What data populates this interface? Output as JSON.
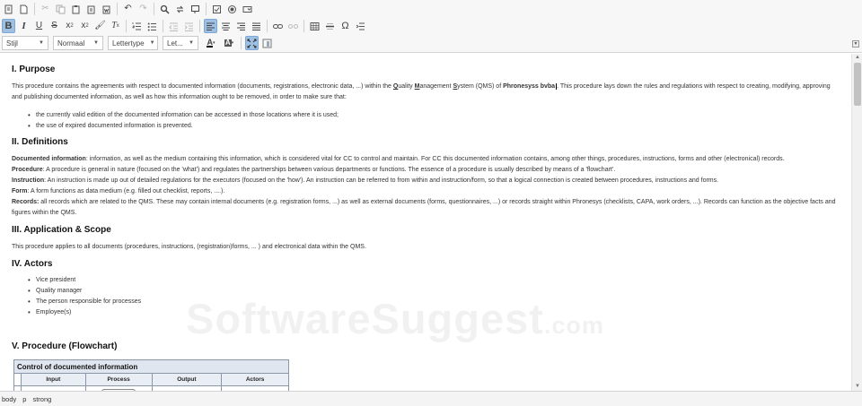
{
  "toolbar": {
    "style_combo": "Stijl",
    "format_combo": "Normaal",
    "font_combo": "Lettertype",
    "size_combo": "Let..."
  },
  "content": {
    "purpose_heading": "I. Purpose",
    "purpose_text_1": "This procedure contains the agreements with respect to documented information (documents, registrations, electronic data, ...) within the ",
    "qms_q": "Q",
    "qms_uality": "uality ",
    "qms_m": "M",
    "qms_anagement": "anagement ",
    "qms_s": "S",
    "qms_ystem": "ystem (QMS) of ",
    "company": "Phronesyss bvba",
    "purpose_text_2": ". This procedure lays down the rules and regulations with respect to creating, modifying, approving and publishing documented information, as well as how this information ought to be removed, in order to make sure that:",
    "purpose_bullets": [
      "the currently valid edition of the documented information can be accessed in those locations where it is used;",
      "the use of expired documented information is prevented."
    ],
    "definitions_heading": "II. Definitions",
    "definitions": [
      {
        "term": "Documented information",
        "text": ": information, as well as the medium containing this information, which is considered vital for CC to control and maintain. For CC this documented information contains, among other things, procedures, instructions, forms and other (electronical) records."
      },
      {
        "term": "Procedure",
        "text": ": A procedure is general in nature (focused on the 'what') and regulates the partnerships between various departments or functions. The essence of a procedure is usually described by means of a 'flowchart'."
      },
      {
        "term": "Instruction",
        "text": ": An instruction is made up out of detailed regulations for the executors (focused on the 'how'). An instruction can be referred to from within and instruction/form, so that a logical connection is created between procedures, instructions and forms."
      },
      {
        "term": "Form",
        "text": ": A form functions as data medium (e.g. filled out checklist, reports, ....)."
      },
      {
        "term": "Records:",
        "text": " all records which are related to the QMS. These may contain internal documents (e.g. registration forms, ...) as well as external documents (forms, questionnaires, ...) or records straight within Phronesys (checklists, CAPA, work orders, ...). Records can function as the objective facts and figures within the QMS."
      }
    ],
    "scope_heading": "III. Application & Scope",
    "scope_text": "This procedure applies to all documents (procedures, instructions, (registration)forms, ... ) and electronical data within the QMS.",
    "actors_heading": "IV. Actors",
    "actors": [
      "Vice president",
      "Quality manager",
      "The person responsible for processes",
      "Employee(s)"
    ],
    "procedure_heading": "V. Procedure (Flowchart)",
    "flow_title": "Control of documented information",
    "flow_columns": [
      "Input",
      "Process",
      "Output",
      "Actors"
    ]
  },
  "watermark": {
    "main": "SoftwareSuggest",
    "suffix": ".com"
  },
  "statusbar": {
    "path": [
      "body",
      "p",
      "strong"
    ]
  }
}
